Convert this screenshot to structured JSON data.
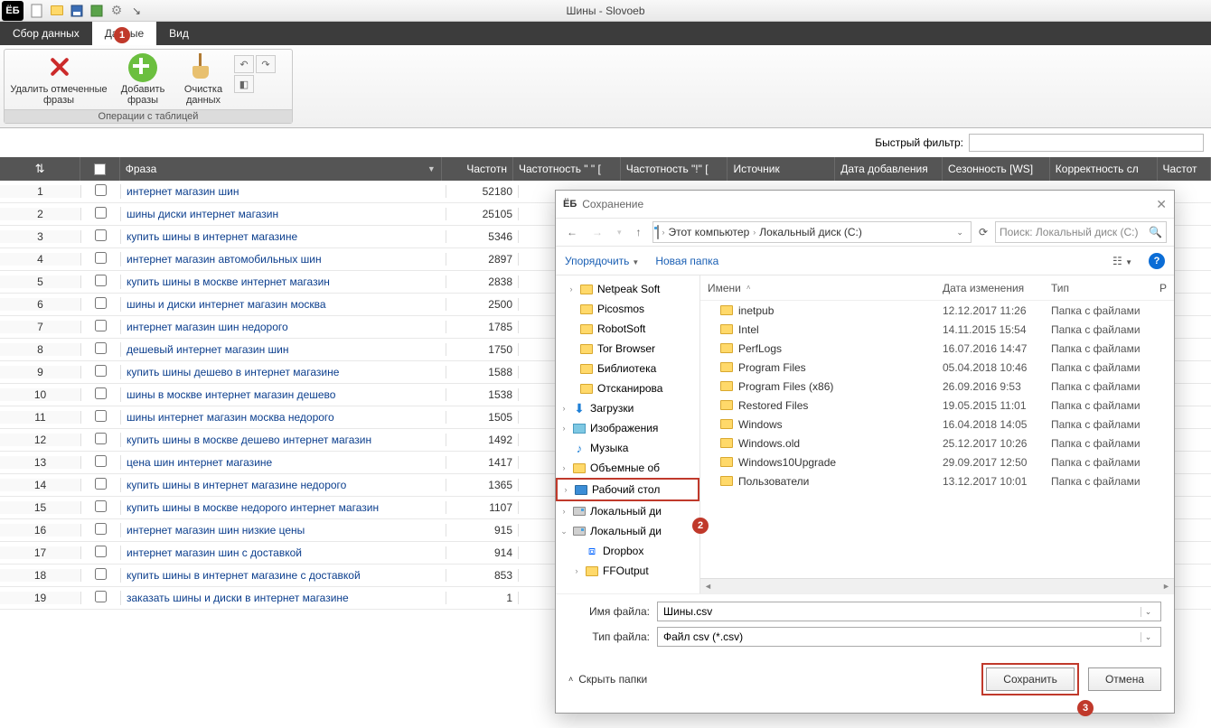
{
  "window_title": "Шины - Slovoeb",
  "logo_text": "ЁБ",
  "tabs": {
    "collect": "Сбор данных",
    "data": "Данные",
    "view": "Вид"
  },
  "ribbon": {
    "remove_marked": "Удалить отмеченные\nфразы",
    "add_phrases": "Добавить\nфразы",
    "clean_data": "Очистка\nданных",
    "group_title": "Операции с таблицей"
  },
  "filter_label": "Быстрый фильтр:",
  "columns": {
    "phrase": "Фраза",
    "freq": "Частотн",
    "freq_quoted": "Частотность \" \" [",
    "freq_exact": "Частотность \"!\" [",
    "source": "Источник",
    "date_added": "Дата добавления",
    "seasonality": "Сезонность [WS]",
    "correctness": "Корректность сл",
    "freq4": "Частот"
  },
  "rows": [
    {
      "n": 1,
      "phrase": "интернет магазин шин",
      "freq": "52180"
    },
    {
      "n": 2,
      "phrase": "шины диски интернет магазин",
      "freq": "25105"
    },
    {
      "n": 3,
      "phrase": "купить шины в интернет магазине",
      "freq": "5346"
    },
    {
      "n": 4,
      "phrase": "интернет магазин автомобильных шин",
      "freq": "2897"
    },
    {
      "n": 5,
      "phrase": "купить шины в москве интернет магазин",
      "freq": "2838"
    },
    {
      "n": 6,
      "phrase": "шины и диски интернет магазин москва",
      "freq": "2500"
    },
    {
      "n": 7,
      "phrase": "интернет магазин шин недорого",
      "freq": "1785"
    },
    {
      "n": 8,
      "phrase": "дешевый интернет магазин шин",
      "freq": "1750"
    },
    {
      "n": 9,
      "phrase": "купить шины дешево в интернет магазине",
      "freq": "1588"
    },
    {
      "n": 10,
      "phrase": "шины в москве интернет магазин дешево",
      "freq": "1538"
    },
    {
      "n": 11,
      "phrase": "шины интернет магазин москва недорого",
      "freq": "1505"
    },
    {
      "n": 12,
      "phrase": "купить шины в москве дешево интернет магазин",
      "freq": "1492"
    },
    {
      "n": 13,
      "phrase": "цена шин интернет магазине",
      "freq": "1417"
    },
    {
      "n": 14,
      "phrase": "купить шины в интернет магазине недорого",
      "freq": "1365"
    },
    {
      "n": 15,
      "phrase": "купить шины в москве недорого интернет магазин",
      "freq": "1107"
    },
    {
      "n": 16,
      "phrase": "интернет магазин шин низкие цены",
      "freq": "915"
    },
    {
      "n": 17,
      "phrase": "интернет магазин шин с доставкой",
      "freq": "914"
    },
    {
      "n": 18,
      "phrase": "купить шины в интернет магазине с доставкой",
      "freq": "853"
    },
    {
      "n": 19,
      "phrase": "заказать шины и диски в интернет магазине",
      "freq": "1"
    }
  ],
  "dialog": {
    "title": "Сохранение",
    "crumbs": {
      "this_pc": "Этот компьютер",
      "drive": "Локальный диск (C:)"
    },
    "search_placeholder": "Поиск: Локальный диск (C:)",
    "organize": "Упорядочить",
    "new_folder": "Новая папка",
    "tree": {
      "netpeak": "Netpeak Soft",
      "picosmos": "Picosmos",
      "robotsoft": "RobotSoft",
      "tor": "Tor Browser",
      "library": "Библиотека",
      "scanned": "Отсканирова",
      "downloads": "Загрузки",
      "images": "Изображения",
      "music": "Музыка",
      "volumes": "Объемные об",
      "desktop": "Рабочий стол",
      "local_disk": "Локальный ди",
      "local_disk2": "Локальный ди",
      "dropbox": "Dropbox",
      "ffoutput": "FFOutput"
    },
    "file_columns": {
      "name": "Имени",
      "date": "Дата изменения",
      "type": "Тип",
      "p": "Р"
    },
    "files": [
      {
        "name": "inetpub",
        "date": "12.12.2017 11:26",
        "type": "Папка с файлами"
      },
      {
        "name": "Intel",
        "date": "14.11.2015 15:54",
        "type": "Папка с файлами"
      },
      {
        "name": "PerfLogs",
        "date": "16.07.2016 14:47",
        "type": "Папка с файлами"
      },
      {
        "name": "Program Files",
        "date": "05.04.2018 10:46",
        "type": "Папка с файлами"
      },
      {
        "name": "Program Files (x86)",
        "date": "26.09.2016 9:53",
        "type": "Папка с файлами"
      },
      {
        "name": "Restored Files",
        "date": "19.05.2015 11:01",
        "type": "Папка с файлами"
      },
      {
        "name": "Windows",
        "date": "16.04.2018 14:05",
        "type": "Папка с файлами"
      },
      {
        "name": "Windows.old",
        "date": "25.12.2017 10:26",
        "type": "Папка с файлами"
      },
      {
        "name": "Windows10Upgrade",
        "date": "29.09.2017 12:50",
        "type": "Папка с файлами"
      },
      {
        "name": "Пользователи",
        "date": "13.12.2017 10:01",
        "type": "Папка с файлами"
      }
    ],
    "filename_label": "Имя файла:",
    "filename_value": "Шины.csv",
    "filetype_label": "Тип файла:",
    "filetype_value": "Файл csv (*.csv)",
    "hide_folders": "Скрыть папки",
    "save": "Сохранить",
    "cancel": "Отмена"
  }
}
